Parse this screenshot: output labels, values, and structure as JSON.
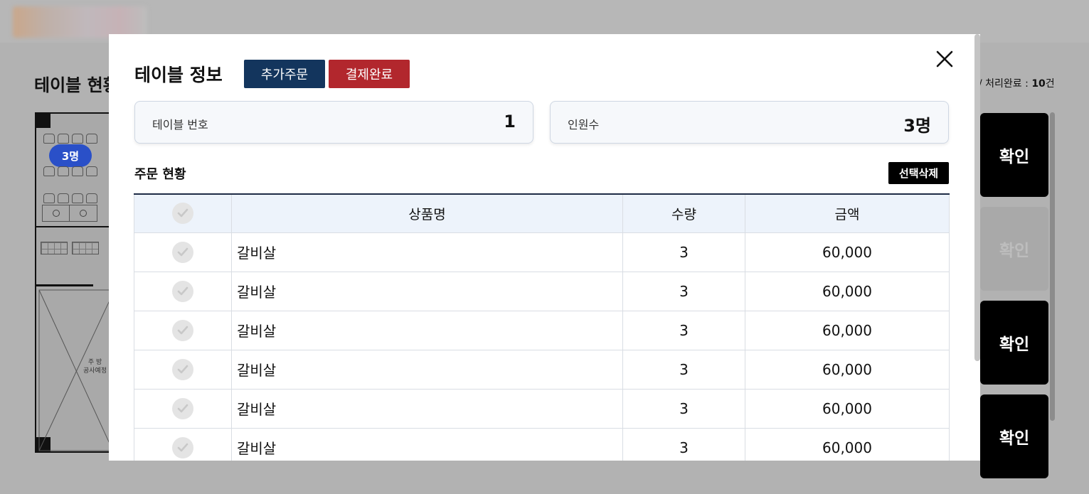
{
  "background": {
    "page_title": "테이블 현황",
    "status_summary": {
      "prefix": "/ 처리완료 : ",
      "count": "10",
      "unit": "건"
    },
    "floorplan": {
      "people_badge": "3명",
      "kitchen_label": "주 방",
      "kitchen_sublabel": "공사예정"
    },
    "confirm_buttons": [
      {
        "label": "확인",
        "state": "active"
      },
      {
        "label": "확인",
        "state": "done"
      },
      {
        "label": "확인",
        "state": "active"
      },
      {
        "label": "확인",
        "state": "active"
      }
    ]
  },
  "modal": {
    "title": "테이블 정보",
    "add_order_label": "추가주문",
    "payment_done_label": "결제완료",
    "close_icon": "close-icon",
    "table_number": {
      "label": "테이블 번호",
      "value": "1"
    },
    "party_size": {
      "label": "인원수",
      "value": "3명"
    },
    "section_title": "주문 현황",
    "delete_selected_label": "선택삭제",
    "columns": {
      "product": "상품명",
      "quantity": "수량",
      "amount": "금액"
    },
    "rows": [
      {
        "product": "갈비살",
        "quantity": "3",
        "amount": "60,000"
      },
      {
        "product": "갈비살",
        "quantity": "3",
        "amount": "60,000"
      },
      {
        "product": "갈비살",
        "quantity": "3",
        "amount": "60,000"
      },
      {
        "product": "갈비살",
        "quantity": "3",
        "amount": "60,000"
      },
      {
        "product": "갈비살",
        "quantity": "3",
        "amount": "60,000"
      },
      {
        "product": "갈비살",
        "quantity": "3",
        "amount": "60,000"
      }
    ]
  },
  "colors": {
    "add_order_button": "#13355d",
    "payment_done_button": "#b2272d",
    "badge": "#2a50c8",
    "header_row": "#edf3fb"
  }
}
